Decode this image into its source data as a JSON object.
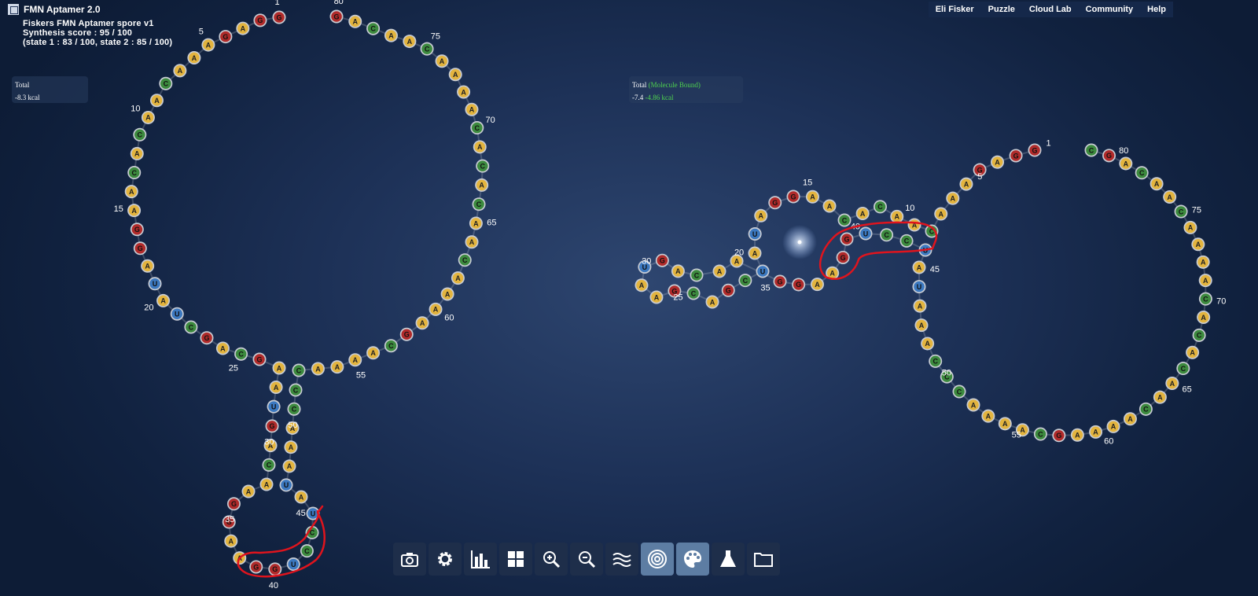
{
  "app": {
    "title": "FMN Aptamer 2.0",
    "logo_icon": "eterna-logo-icon"
  },
  "puzzle": {
    "name": "Fiskers FMN Aptamer  spore v1",
    "score": "Synthesis score : 95 / 100",
    "states": "(state 1 : 83 / 100, state 2 : 85 / 100)"
  },
  "nav": [
    "Eli Fisker",
    "Puzzle",
    "Cloud Lab",
    "Community",
    "Help"
  ],
  "energy_left": {
    "label": "Total",
    "value": "-8.3 kcal"
  },
  "energy_right": {
    "label": "Total",
    "note": "(Molecule Bound)",
    "value": "-7.4",
    "value_bound": "-4.86 kcal"
  },
  "colors": {
    "A": "#e3b43e",
    "C": "#3c8a3e",
    "G": "#b02a2a",
    "U": "#3b78c0",
    "annotation": "#e0141d"
  },
  "state1_sequence": "GGAGAAACAACACAAGGAUAUCGACGAAUGACAAGGAAGGUCCUAUAAACCCAAAACGAAAACAACACACAAAACAACAGC",
  "state2_sequence": "GGAGAAACAACACAAGGAUAUCGACGAAUGACAAGGAAGGUCCUAUAAACCCAAAACGAAAACAACACACAAAACAACAGC",
  "state1_labels": [
    1,
    5,
    10,
    15,
    20,
    25,
    30,
    35,
    40,
    45,
    50,
    55,
    60,
    65,
    70,
    75,
    80
  ],
  "state2_labels": [
    1,
    5,
    10,
    15,
    20,
    25,
    30,
    35,
    40,
    45,
    50,
    55,
    60,
    65,
    70,
    75,
    80
  ],
  "toolbar": [
    {
      "name": "screenshot-button",
      "icon": "camera-icon",
      "active": false
    },
    {
      "name": "settings-button",
      "icon": "gear-icon",
      "active": false
    },
    {
      "name": "stats-button",
      "icon": "bar-chart-icon",
      "active": false
    },
    {
      "name": "layout-button",
      "icon": "grid-icon",
      "active": false
    },
    {
      "name": "zoom-in-button",
      "icon": "zoom-in-icon",
      "active": false
    },
    {
      "name": "zoom-out-button",
      "icon": "zoom-out-icon",
      "active": false
    },
    {
      "name": "native-mode-button",
      "icon": "wave-lines-icon",
      "active": false
    },
    {
      "name": "target-mode-button",
      "icon": "target-icon",
      "active": true
    },
    {
      "name": "palette-button",
      "icon": "palette-icon",
      "active": true
    },
    {
      "name": "lab-button",
      "icon": "flask-icon",
      "active": false
    },
    {
      "name": "folder-button",
      "icon": "folder-icon",
      "active": false
    }
  ]
}
